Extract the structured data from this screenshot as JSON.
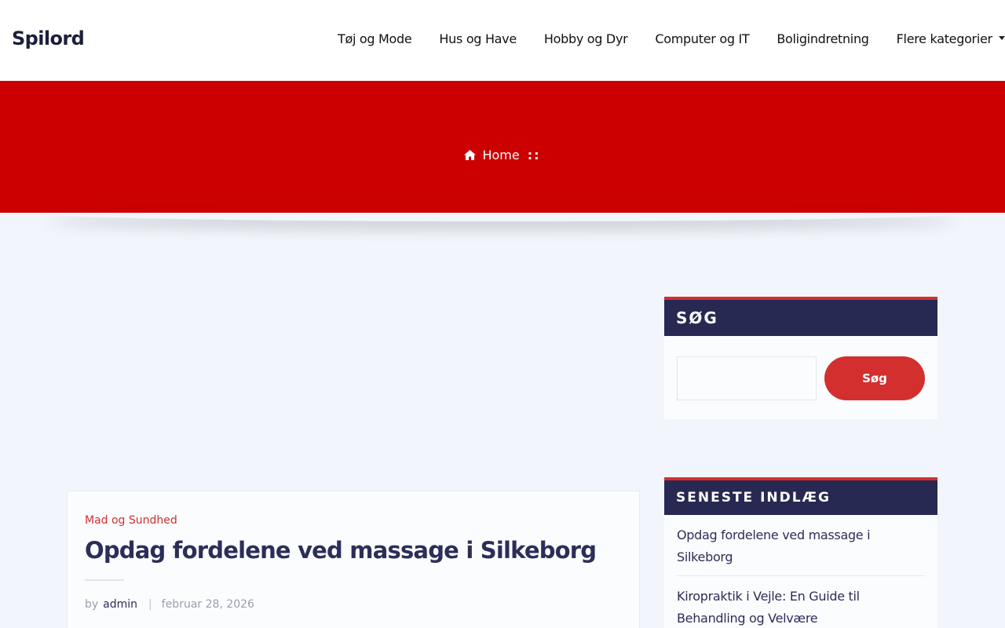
{
  "site": {
    "logo": "Spilord"
  },
  "nav": {
    "items": [
      "Tøj og Mode",
      "Hus og Have",
      "Hobby og Dyr",
      "Computer og IT",
      "Boligindretning"
    ],
    "more_label": "Flere kategorier"
  },
  "breadcrumb": {
    "home_label": "Home",
    "separator": "::"
  },
  "post": {
    "category": "Mad og Sundhed",
    "title": "Opdag fordelene ved massage i Silkeborg",
    "by_label": "by",
    "author": "admin",
    "date": "februar 28, 2026"
  },
  "sidebar": {
    "search": {
      "heading": "SØG",
      "button_label": "Søg"
    },
    "recent": {
      "heading": "SENESTE INDLÆG",
      "items": [
        "Opdag fordelene ved massage i Silkeborg",
        "Kiropraktik i Vejle: En Guide til Behandling og Velvære"
      ]
    }
  },
  "colors": {
    "accent": "#cc0000",
    "brand_navy": "#272952",
    "button_red": "#d32f2f"
  }
}
